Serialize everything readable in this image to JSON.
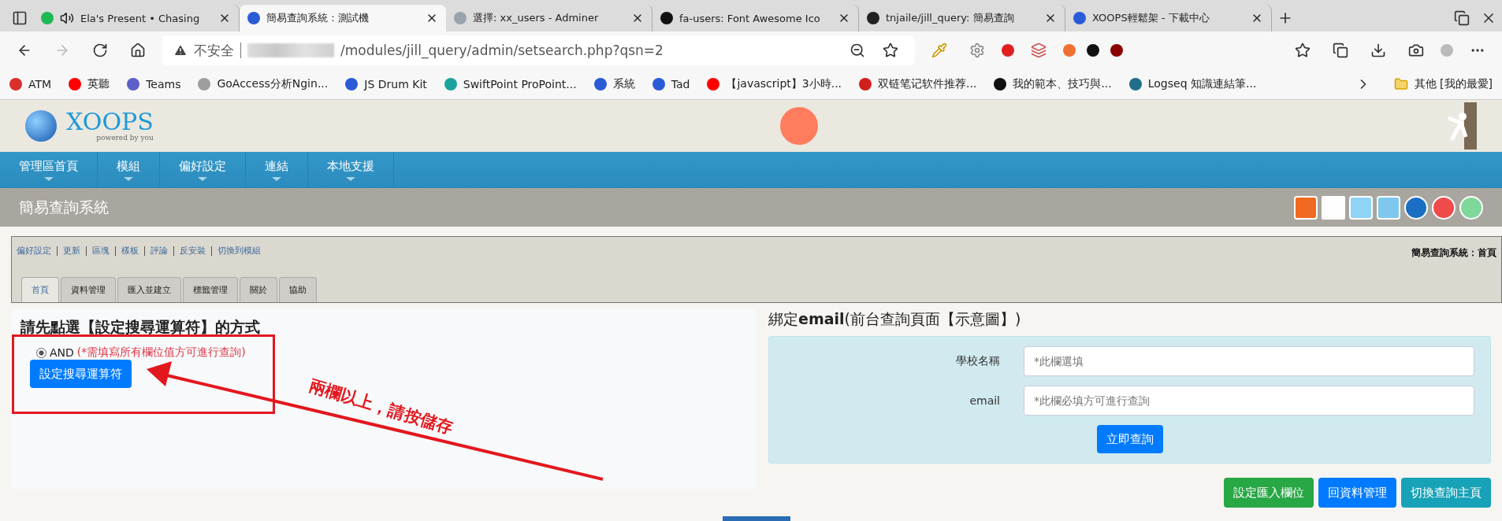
{
  "browser": {
    "tabs": [
      {
        "title": "Ela's Present • Chasing",
        "selected": false,
        "playing": true,
        "color": "#1db954"
      },
      {
        "title": "簡易查詢系統 : 測試機",
        "selected": true,
        "playing": false,
        "color": "#2a5bd7"
      },
      {
        "title": "選擇: xx_users - Adminer",
        "selected": false,
        "playing": false,
        "color": "#9aa3ad"
      },
      {
        "title": "fa-users: Font Awesome Ico",
        "selected": false,
        "playing": false,
        "color": "#111111"
      },
      {
        "title": "tnjaile/jill_query: 簡易查詢",
        "selected": false,
        "playing": false,
        "color": "#222222"
      },
      {
        "title": "XOOPS輕鬆架 - 下載中心",
        "selected": false,
        "playing": false,
        "color": "#2a5bd7"
      }
    ],
    "address": {
      "warning": "不安全",
      "url": "/modules/jill_query/admin/setsearch.php?qsn=2"
    },
    "bookmarks": [
      {
        "label": "ATM",
        "color": "#d9302c"
      },
      {
        "label": "英聽",
        "color": "#ff0000"
      },
      {
        "label": "Teams",
        "color": "#5b5fc7"
      },
      {
        "label": "GoAccess分析Ngin...",
        "color": "#9e9e9e"
      },
      {
        "label": "JS Drum Kit",
        "color": "#2a5bd7"
      },
      {
        "label": "SwiftPoint ProPoint...",
        "color": "#1aa39a"
      },
      {
        "label": "系統",
        "color": "#2a5bd7"
      },
      {
        "label": "Tad",
        "color": "#2a5bd7"
      },
      {
        "label": "【javascript】3小時...",
        "color": "#ff0000"
      },
      {
        "label": "双链笔记软件推荐...",
        "color": "#d0201c"
      },
      {
        "label": "我的範本、技巧與...",
        "color": "#111111"
      },
      {
        "label": "Logseq 知識連結筆...",
        "color": "#1f6f8b"
      }
    ],
    "other_bookmarks": "其他 [我的最愛]"
  },
  "site": {
    "logo": "XOOPS",
    "tagline": "powered by you",
    "nav": [
      "管理區首頁",
      "模組",
      "偏好設定",
      "連結",
      "本地支援"
    ],
    "module_title": "簡易查詢系統",
    "admin_links": [
      "偏好設定",
      "更新",
      "區塊",
      "樣板",
      "評論",
      "反安裝",
      "切換到模組"
    ],
    "breadcrumb": "簡易查詢系統：首頁",
    "tabs": [
      {
        "label": "首頁",
        "selected": true
      },
      {
        "label": "資料管理",
        "selected": false
      },
      {
        "label": "匯入並建立",
        "selected": false
      },
      {
        "label": "標籤管理",
        "selected": false
      },
      {
        "label": "關於",
        "selected": false
      },
      {
        "label": "協助",
        "selected": false
      }
    ],
    "operator_panel": {
      "heading": "請先點選【設定搜尋運算符】的方式",
      "options": [
        {
          "label": "AND",
          "note": "(*需填寫所有欄位值方可進行查詢)",
          "selected": true
        }
      ],
      "button": "設定搜尋運算符",
      "annotation": "兩欄以上，請按儲存"
    },
    "query_preview": {
      "heading": "綁定**email**(前台查詢頁面【示意圖】)",
      "fields": [
        {
          "label": "學校名稱",
          "placeholder": "*此欄選填"
        },
        {
          "label": "email",
          "placeholder": "*此欄必填方可進行查詢"
        }
      ],
      "submit": "立即查詢"
    },
    "actions": [
      {
        "label": "設定匯入欄位",
        "color": "#28a745"
      },
      {
        "label": "回資料管理",
        "color": "#007bff"
      },
      {
        "label": "切換查詢主頁",
        "color": "#17a2b8"
      }
    ]
  }
}
